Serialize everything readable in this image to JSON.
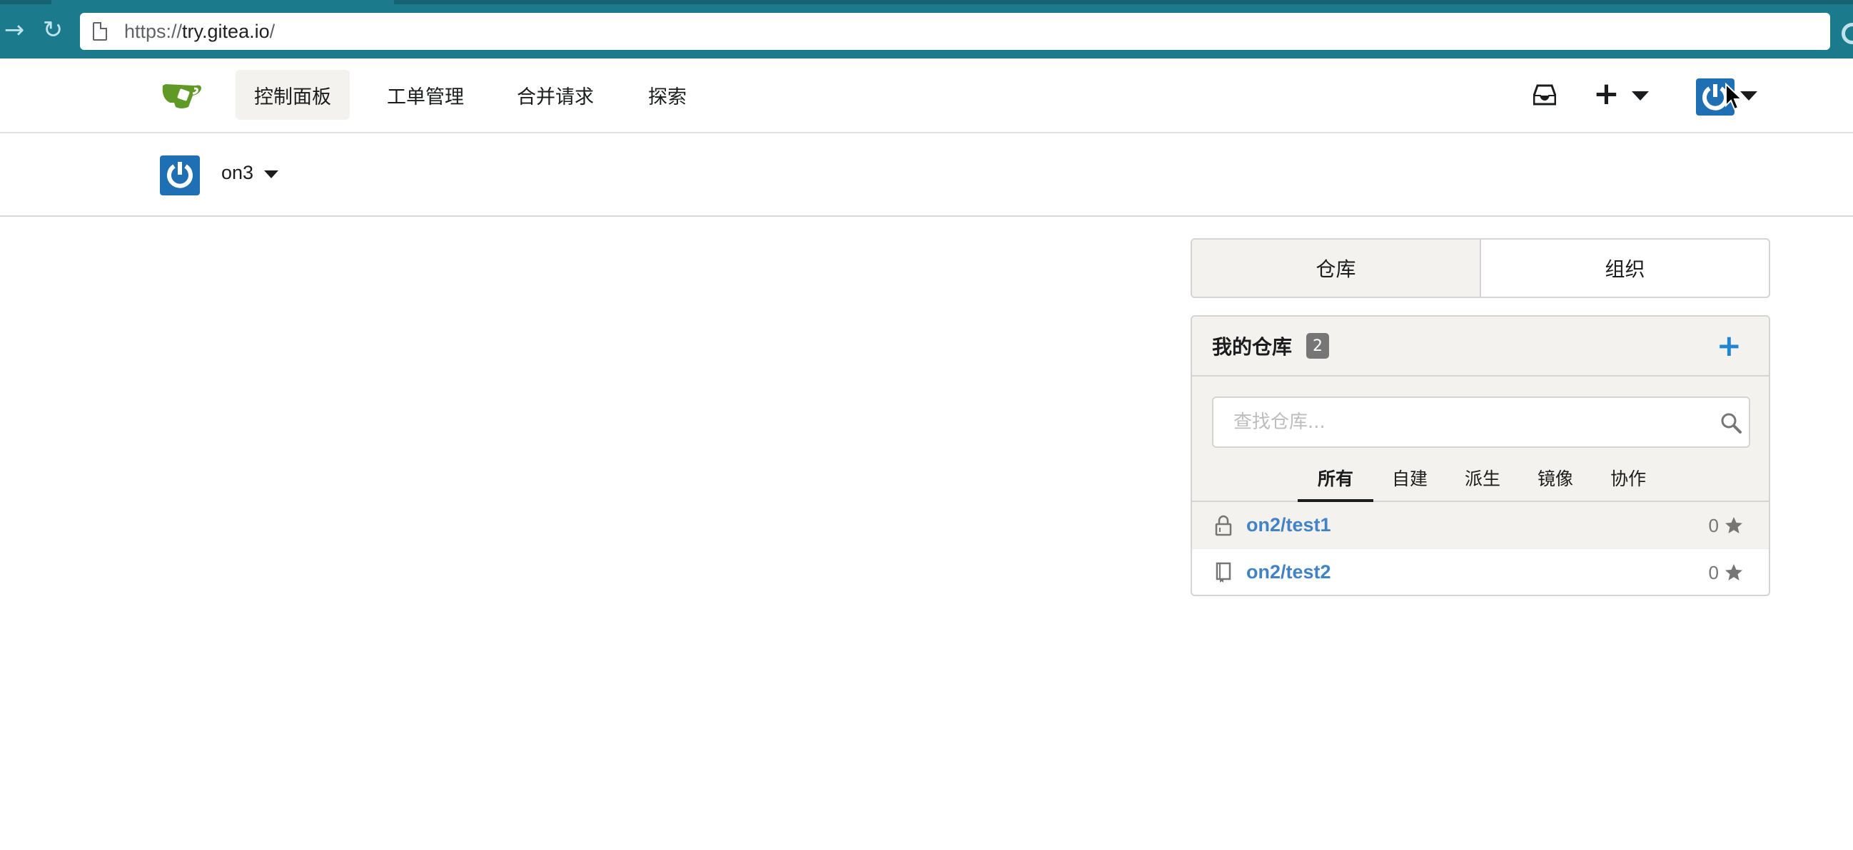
{
  "browser": {
    "url_scheme": "https://",
    "url_host": "try.gitea.io",
    "url_path": "/"
  },
  "nav": {
    "items": [
      {
        "label": "控制面板",
        "active": true
      },
      {
        "label": "工单管理",
        "active": false
      },
      {
        "label": "合并请求",
        "active": false
      },
      {
        "label": "探索",
        "active": false
      }
    ]
  },
  "context": {
    "username": "on3"
  },
  "panel": {
    "switch_tabs": [
      {
        "label": "仓库",
        "active": true
      },
      {
        "label": "组织",
        "active": false
      }
    ],
    "repos": {
      "title": "我的仓库",
      "count": "2",
      "add_label": "+",
      "search_placeholder": "查找仓库...",
      "filters": [
        {
          "label": "所有",
          "active": true
        },
        {
          "label": "自建",
          "active": false
        },
        {
          "label": "派生",
          "active": false
        },
        {
          "label": "镜像",
          "active": false
        },
        {
          "label": "协作",
          "active": false
        }
      ],
      "list": [
        {
          "name": "on2/test1",
          "stars": "0",
          "icon": "lock-icon"
        },
        {
          "name": "on2/test2",
          "stars": "0",
          "icon": "book-icon"
        }
      ]
    }
  },
  "colors": {
    "browser_bar": "#1b7a8c",
    "avatar": "#1f6fb5",
    "link": "#4183c4",
    "accent_add": "#2185d0",
    "logo_green": "#609926"
  }
}
